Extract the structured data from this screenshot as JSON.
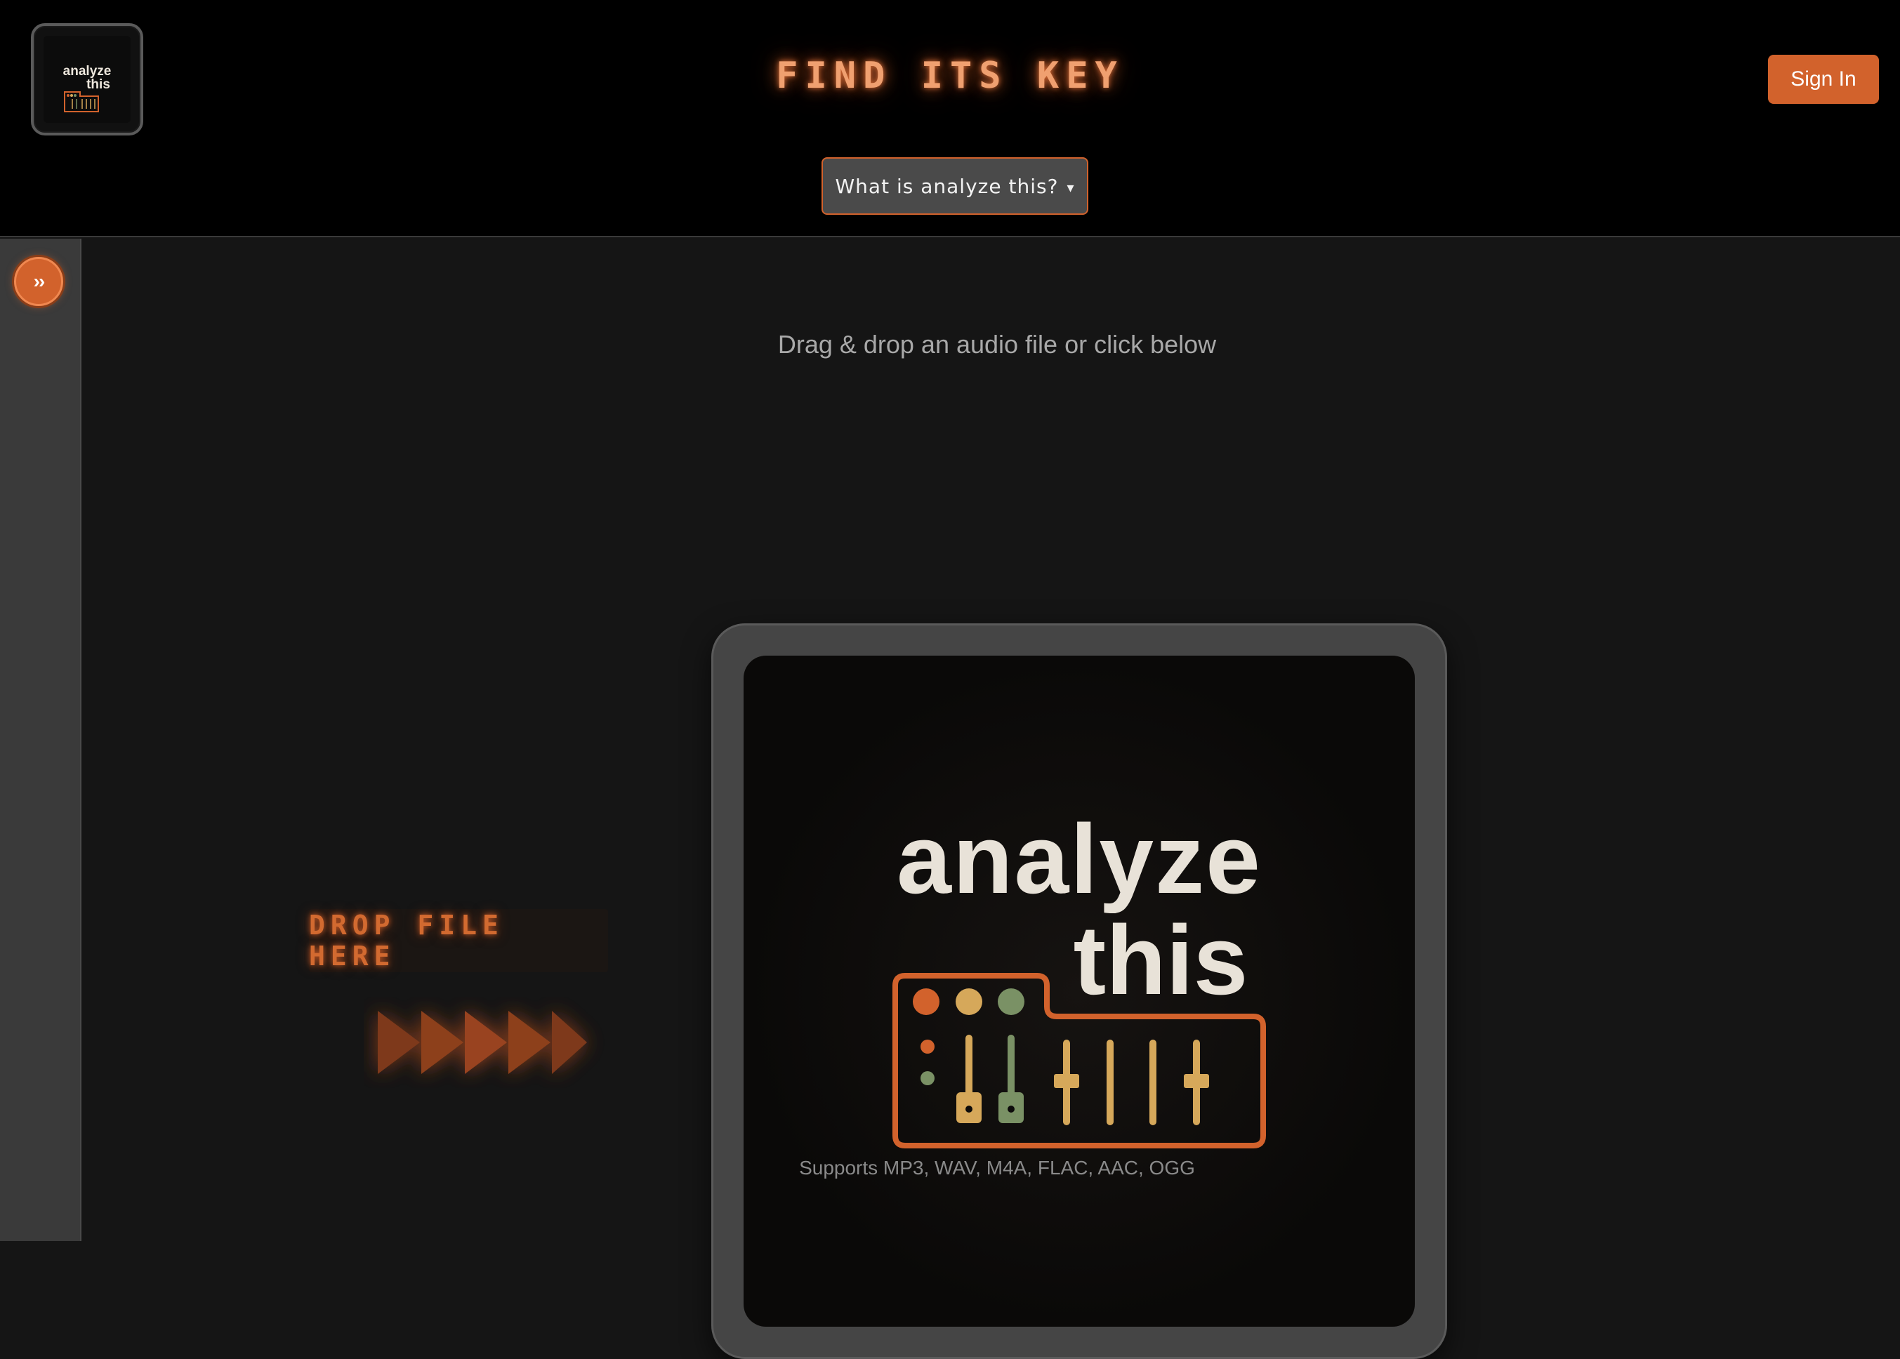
{
  "header": {
    "logo": {
      "line1": "analyze",
      "line2": "this"
    },
    "title": "FIND ITS KEY",
    "sign_in_label": "Sign In",
    "about_dropdown_label": "What is analyze this?",
    "about_dropdown_caret": "▾"
  },
  "sidebar": {
    "expand_label": "››"
  },
  "main": {
    "hint": "Drag & drop an audio file or click below",
    "drop_label": "DROP FILE HERE",
    "dropzone_logo": {
      "line1": "analyze",
      "line2": "this"
    },
    "supported_formats": "Supports MP3, WAV, M4A, FLAC, AAC, OGG"
  },
  "colors": {
    "accent": "#d2622c",
    "logo_orange": "#d2622c",
    "logo_yellow": "#d6a85a",
    "logo_green": "#7a9165",
    "logo_text": "#e8e2d8"
  }
}
